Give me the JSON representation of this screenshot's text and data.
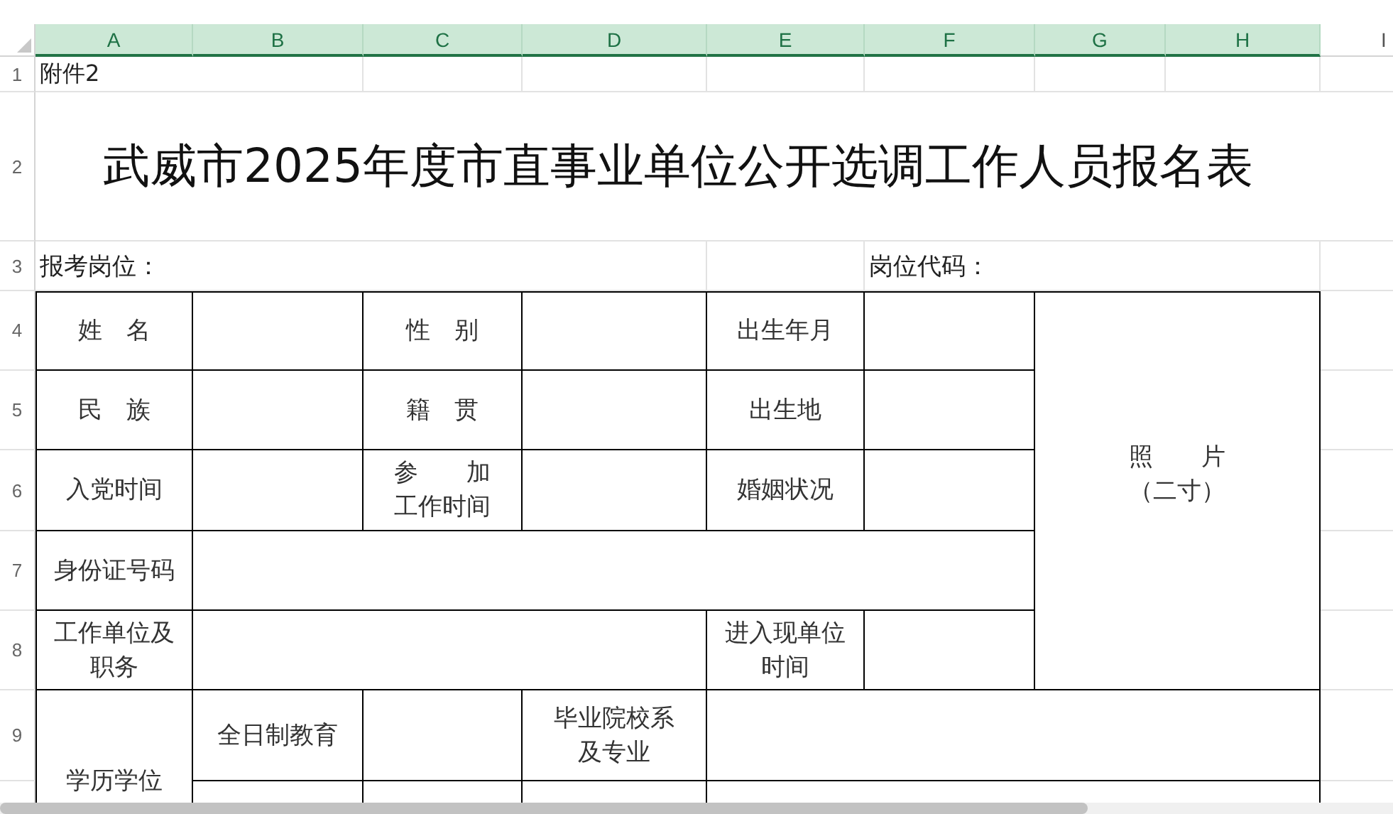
{
  "column_headers": [
    {
      "label": "A",
      "selected": true
    },
    {
      "label": "B",
      "selected": true
    },
    {
      "label": "C",
      "selected": true
    },
    {
      "label": "D",
      "selected": true
    },
    {
      "label": "E",
      "selected": true
    },
    {
      "label": "F",
      "selected": true
    },
    {
      "label": "G",
      "selected": true
    },
    {
      "label": "H",
      "selected": true
    },
    {
      "label": "I",
      "selected": false
    }
  ],
  "row_headers": [
    "1",
    "2",
    "3",
    "4",
    "5",
    "6",
    "7",
    "8",
    "9"
  ],
  "sheet": {
    "attachment_label": "附件2",
    "title": "武威市2025年度市直事业单位公开选调工作人员报名表",
    "position_label": "报考岗位：",
    "position_code_label": "岗位代码：",
    "form_labels": [
      {
        "lines": [
          "姓　名"
        ]
      },
      {
        "lines": [
          "性　别"
        ]
      },
      {
        "lines": [
          "出生年月"
        ]
      },
      {
        "lines": [
          "照　　片",
          "（二寸）"
        ]
      },
      {
        "lines": [
          "民　族"
        ]
      },
      {
        "lines": [
          "籍　贯"
        ]
      },
      {
        "lines": [
          "出生地"
        ]
      },
      {
        "lines": [
          "入党时间"
        ]
      },
      {
        "lines": [
          "参　　加",
          "工作时间"
        ]
      },
      {
        "lines": [
          "婚姻状况"
        ]
      },
      {
        "lines": [
          "身份证号码"
        ]
      },
      {
        "lines": [
          "工作单位及",
          "职务"
        ]
      },
      {
        "lines": [
          "进入现单位",
          "时间"
        ]
      },
      {
        "lines": [
          "学历学位"
        ]
      },
      {
        "lines": [
          "全日制教育"
        ]
      },
      {
        "lines": [
          "毕业院校系",
          "及专业"
        ]
      }
    ]
  }
}
